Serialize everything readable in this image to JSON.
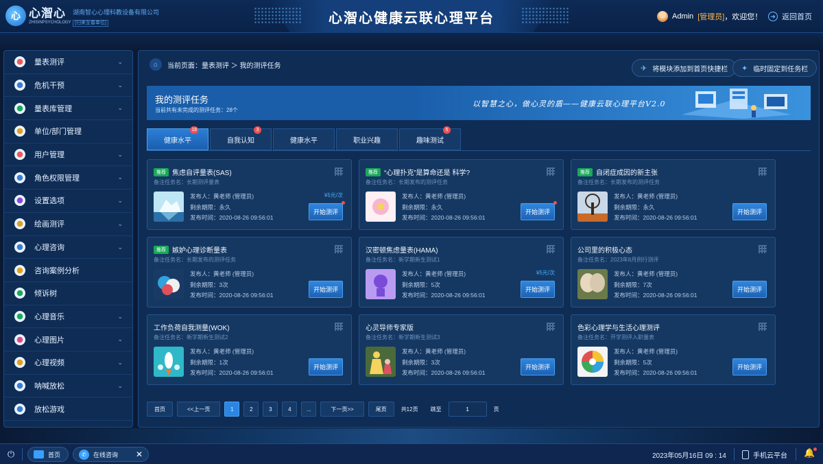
{
  "header": {
    "logo_name": "心潪心",
    "logo_sub": "ZHISINPSYCHOLOGY",
    "company_name": "湖南智心心理科教设备有限公司",
    "company_tag": "[归来至春单位]",
    "title": "心潪心健康云联心理平台",
    "user_name": "Admin",
    "user_role": "[管理员]",
    "greeting": "，欢迎您！",
    "home_link": "返回首页"
  },
  "sidebar": {
    "items": [
      {
        "label": "量表测评",
        "icon": "heart-icon",
        "color": "#f05a5a",
        "chevron": true
      },
      {
        "label": "危机干预",
        "icon": "shield-icon",
        "color": "#3a7bd5",
        "chevron": true
      },
      {
        "label": "量表库管理",
        "icon": "database-icon",
        "color": "#19a95a",
        "chevron": true
      },
      {
        "label": "单位/部门管理",
        "icon": "building-icon",
        "color": "#e0a020",
        "chevron": false
      },
      {
        "label": "用户管理",
        "icon": "user-icon",
        "color": "#f05a5a",
        "chevron": true
      },
      {
        "label": "角色权限管理",
        "icon": "key-icon",
        "color": "#3a7bd5",
        "chevron": true
      },
      {
        "label": "设置选项",
        "icon": "gear-icon",
        "color": "#8a4ad5",
        "chevron": true
      },
      {
        "label": "绘画测评",
        "icon": "palette-icon",
        "color": "#e0a020",
        "chevron": true
      },
      {
        "label": "心理咨询",
        "icon": "chat-icon",
        "color": "#3a7bd5",
        "chevron": true
      },
      {
        "label": "咨询案例分析",
        "icon": "case-icon",
        "color": "#e0a020",
        "chevron": false
      },
      {
        "label": "倾诉树",
        "icon": "tree-icon",
        "color": "#19a95a",
        "chevron": false
      },
      {
        "label": "心理音乐",
        "icon": "music-icon",
        "color": "#19a95a",
        "chevron": true
      },
      {
        "label": "心理图片",
        "icon": "image-icon",
        "color": "#e04a8a",
        "chevron": true
      },
      {
        "label": "心理视频",
        "icon": "video-icon",
        "color": "#e0a020",
        "chevron": true
      },
      {
        "label": "呐喊放松",
        "icon": "speaker-icon",
        "color": "#3a7bd5",
        "chevron": true
      },
      {
        "label": "放松游戏",
        "icon": "gamepad-icon",
        "color": "#3a7bd5",
        "chevron": false
      }
    ]
  },
  "breadcrumb": {
    "prefix": "当前页面：",
    "path": "量表测评 ＞ 我的测评任务"
  },
  "toolbar": {
    "add_shortcut": "将模块添加到首页快捷栏",
    "pin_taskbar": "临时固定到任务栏"
  },
  "banner": {
    "title": "我的测评任务",
    "subtitle": "当前共有未完成的测评任务：28个",
    "slogan": "以智慧之心，做心灵的盾——健康云联心理平台V2.0"
  },
  "tabs": [
    {
      "label": "健康水平",
      "badge": "18",
      "active": true
    },
    {
      "label": "自我认知",
      "badge": "3",
      "active": false
    },
    {
      "label": "健康水平",
      "badge": "",
      "active": false
    },
    {
      "label": "职业兴趣",
      "badge": "",
      "active": false
    },
    {
      "label": "趣味测试",
      "badge": "5",
      "active": false
    }
  ],
  "labels": {
    "publisher": "发布人：",
    "remaining": "剩余期限：",
    "publish_time": "发布时间：",
    "task_name": "备注任务名：",
    "start": "开始测评",
    "tag": "推荐"
  },
  "cards": [
    {
      "tag": true,
      "title": "焦虑自评量表(SAS)",
      "task": "长期测评量表",
      "publisher": "黄老师 (管理员)",
      "remaining": "永久",
      "time": "2020-08-26 09:56:01",
      "price": "¥5元/次",
      "dot": true,
      "thumb": "iceberg"
    },
    {
      "tag": true,
      "title": "“心理扑克”是算命还是 科学?",
      "task": "长期发布的测评任务",
      "publisher": "黄老师 (管理员)",
      "remaining": "永久",
      "time": "2020-08-26 09:56:01",
      "price": "",
      "dot": true,
      "thumb": "flower"
    },
    {
      "tag": true,
      "title": "自闭症成因的新主张",
      "task": "长期发布的测评任务",
      "publisher": "黄老师 (管理员)",
      "remaining": "永久",
      "time": "2020-08-26 09:56:01",
      "price": "",
      "dot": false,
      "thumb": "tree"
    },
    {
      "tag": true,
      "title": "嫉妒心理诊断量表",
      "task": "长期发布的测评任务",
      "publisher": "黄老师 (管理员)",
      "remaining": "3次",
      "time": "2020-08-26 09:56:01",
      "price": "",
      "dot": false,
      "thumb": "heads"
    },
    {
      "tag": false,
      "title": "汉密顿焦虑量表(HAMA)",
      "task": "新学期新生测试1",
      "publisher": "黄老师 (管理员)",
      "remaining": "5次",
      "time": "2020-08-26 09:56:01",
      "price": "¥5元/次",
      "dot": false,
      "thumb": "brain"
    },
    {
      "tag": false,
      "title": "公司里的积极心态",
      "task": "2023年8月例行测评",
      "publisher": "黄老师 (管理员)",
      "remaining": "7次",
      "time": "2020-08-26 09:56:01",
      "price": "",
      "dot": false,
      "thumb": "butterfly"
    },
    {
      "tag": false,
      "title": "工作负荷自我测量(WOK)",
      "task": "新学期新生测试2",
      "publisher": "黄老师 (管理员)",
      "remaining": "1次",
      "time": "2020-08-26 09:56:01",
      "price": "",
      "dot": false,
      "thumb": "rocket"
    },
    {
      "tag": false,
      "title": "心灵导师专家版",
      "task": "新学期新生测试3",
      "publisher": "黄老师 (管理员)",
      "remaining": "3次",
      "time": "2020-08-26 09:56:01",
      "price": "",
      "dot": false,
      "thumb": "family"
    },
    {
      "tag": false,
      "title": "色彩心理学与生活心理测评",
      "task": "开学测评入职量表",
      "publisher": "黄老师 (管理员)",
      "remaining": "5次",
      "time": "2020-08-26 09:56:01",
      "price": "",
      "dot": false,
      "thumb": "spiral"
    }
  ],
  "pager": {
    "first": "首页",
    "prev": "<<上一页",
    "pages": [
      "1",
      "2",
      "3",
      "4",
      "..."
    ],
    "current": "1",
    "next": "下一页>>",
    "last": "尾页",
    "total": "共12页",
    "jump_label": "跳至",
    "jump_value": "1",
    "page_unit": "页"
  },
  "taskbar": {
    "home": "首页",
    "consult": "在线咨询",
    "close": "✕",
    "datetime": "2023年05月16日  09 : 14",
    "phone": "手机云平台"
  }
}
